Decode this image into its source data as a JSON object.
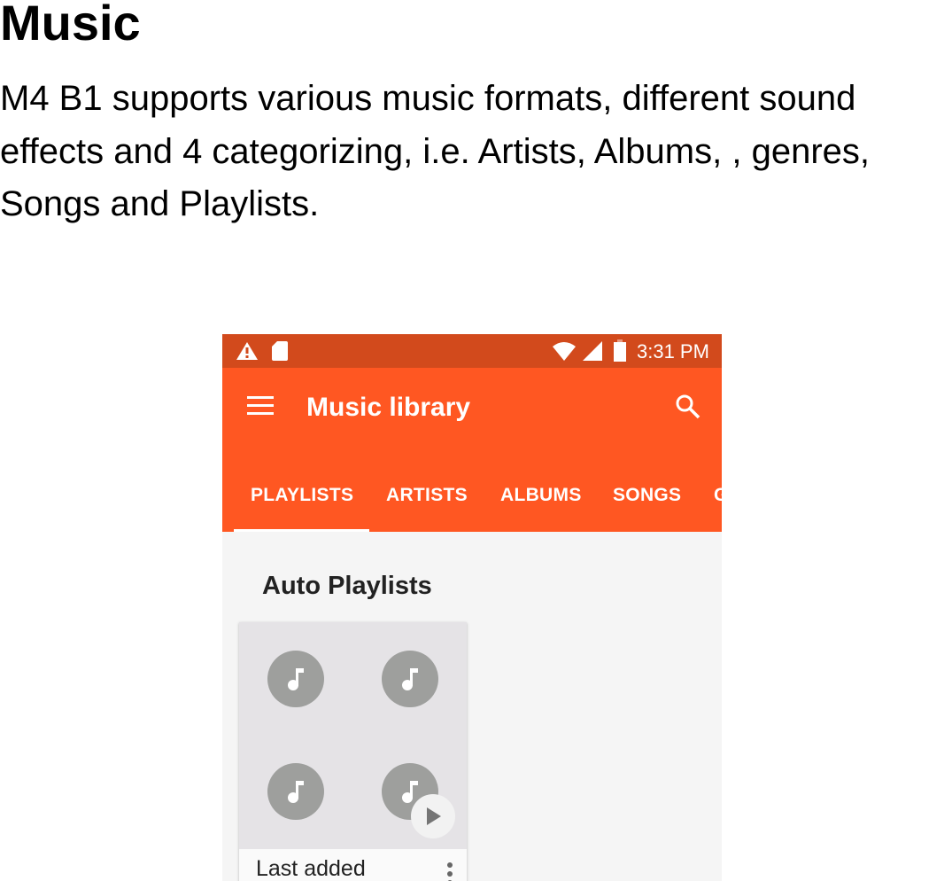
{
  "heading": "Music",
  "paragraph": "M4 B1 supports various music formats, different sound\neffects and 4 categorizing, i.e. Artists, Albums, , genres,\nSongs and Playlists.",
  "phone": {
    "status": {
      "time": "3:31 PM",
      "icons": [
        "warning-icon",
        "sd-card-icon",
        "wifi-icon",
        "signal-icon",
        "battery-icon"
      ],
      "color": "#d24a1c"
    },
    "toolbar": {
      "title": "Music library",
      "menu_icon": "hamburger-menu-icon",
      "search_icon": "search-icon",
      "color": "#ff5722"
    },
    "tabs": [
      {
        "label": "PLAYLISTS",
        "active": true
      },
      {
        "label": "ARTISTS"
      },
      {
        "label": "ALBUMS"
      },
      {
        "label": "SONGS"
      },
      {
        "label": "G"
      }
    ],
    "section_title": "Auto Playlists",
    "cards": [
      {
        "title": "Last added",
        "icons": [
          "music-note-icon",
          "play-icon",
          "more-vert-icon"
        ]
      }
    ]
  }
}
